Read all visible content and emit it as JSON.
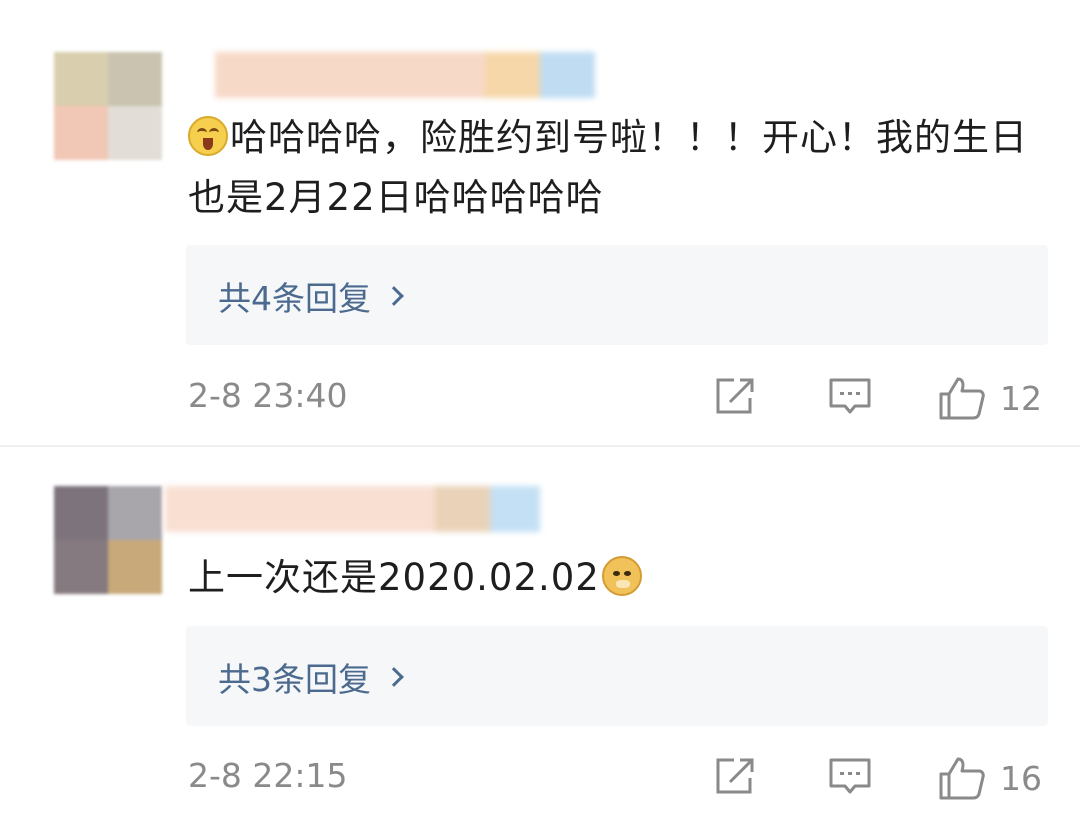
{
  "comments": [
    {
      "text": "哈哈哈哈，险胜约到号啦！！！开心！我的生日也是2月22日哈哈哈哈哈",
      "emoji_before": "laughing-face-emoji",
      "replies_label": "共4条回复",
      "time": "2-8 23:40",
      "likes": "12"
    },
    {
      "text": "上一次还是2020.02.02",
      "emoji_after": "doge-emoji",
      "replies_label": "共3条回复",
      "time": "2-8 22:15",
      "likes": "16"
    }
  ],
  "icons": {
    "share": "share-icon",
    "comment": "comment-icon",
    "like": "thumbs-up-icon"
  },
  "colors": {
    "link": "#4b6a8e",
    "meta": "#8a8a8a",
    "reply_bg": "#f6f7f9"
  }
}
